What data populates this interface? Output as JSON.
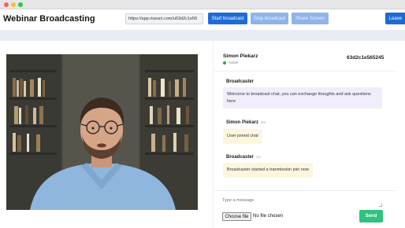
{
  "window": {
    "traffic_lights": [
      "#ff5f57",
      "#febc2e",
      "#28c840"
    ]
  },
  "toolbar": {
    "title": "Webinar Broadcasting",
    "url": "https://app.riseuni.com/u63d2c1e56",
    "start_label": "Start broadcast",
    "stop_label": "Stop broadcast",
    "share_label": "Share Screen",
    "leave_label": "Leave"
  },
  "chat": {
    "user_name": "Simon Piekarz",
    "status": "Active",
    "session_id": "63d2c1e565245",
    "messages": [
      {
        "sender": "Broadcaster",
        "time": "",
        "text": "Welcome to broadcast chat, you can exchange thoughts and ask questions here",
        "style": "purple"
      },
      {
        "sender": "Simon Piekarz",
        "time": "2m",
        "text": "User joined chat",
        "style": "yellow"
      },
      {
        "sender": "Broadcaster",
        "time": "1m",
        "text": "Broadcaster started a tranmission join now",
        "style": "yellow"
      }
    ],
    "input_placeholder": "Type a message",
    "file_button_label": "Choose file",
    "file_status": "No file chosen",
    "send_label": "Send"
  },
  "colors": {
    "accent": "#1f6bd6",
    "accent_disabled": "#8fb3ea",
    "send": "#2ec27e",
    "status_active": "#28a745",
    "bubble_purple": "#f1edfa",
    "bubble_yellow": "#fdf6df"
  }
}
